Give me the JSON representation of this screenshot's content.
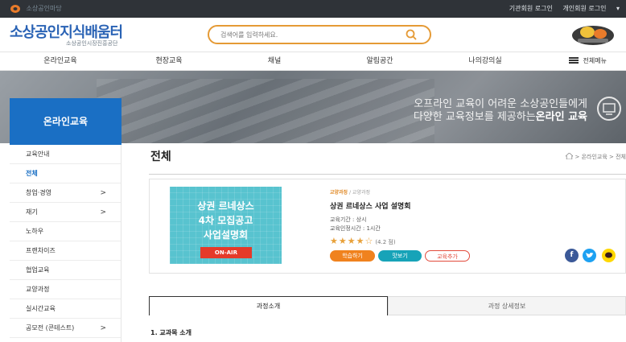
{
  "topbar": {
    "logo_text": "소상공인마당",
    "links": [
      "기관회원 로그인",
      "개인회원 로그인",
      "▾"
    ]
  },
  "header": {
    "brand_main": "소상공인지식배움터",
    "brand_sub": "소상공인시장진흥공단",
    "search_placeholder": "검색어를 입력하세요.",
    "mascot_alt": "소상공인 캐릭터"
  },
  "gnb": {
    "items": [
      "온라인교육",
      "현장교육",
      "채널",
      "알림공간",
      "나의강의실"
    ],
    "all_menu": "전체메뉴"
  },
  "hero": {
    "line1": "오프라인 교육이 어려운 소상공인들에게",
    "line2_prefix": "다양한 교육정보를 제공하는",
    "line2_bold": "온라인 교육"
  },
  "lnb": {
    "title": "온라인교육",
    "items": [
      {
        "label": "교육안내",
        "arrow": ""
      },
      {
        "label": "전체",
        "arrow": ""
      },
      {
        "label": "창업·경영",
        "arrow": ">"
      },
      {
        "label": "재기",
        "arrow": ">"
      },
      {
        "label": "노하우",
        "arrow": ""
      },
      {
        "label": "프랜차이즈",
        "arrow": ""
      },
      {
        "label": "협업교육",
        "arrow": ""
      },
      {
        "label": "교양과정",
        "arrow": ""
      },
      {
        "label": "실시간교육",
        "arrow": ""
      },
      {
        "label": "공모전 (콘테스트)",
        "arrow": ">"
      }
    ]
  },
  "content": {
    "page_title": "전체",
    "breadcrumb": "> 온라인교육 > 전체",
    "card": {
      "thumb_line1": "상권 르네상스",
      "thumb_line2": "4차 모집공고",
      "thumb_line3": "사업설명회",
      "thumb_badge": "ON-AIR",
      "category": "교양과정",
      "category_sep": " / 교양과정",
      "title": "상권 르네상스 사업 설명회",
      "period": "교육기간 : 상시",
      "hours": "교육인정시간 : 1시간",
      "stars": "★★★★☆",
      "score": "(4.2 점)",
      "btn_apply": "학습하기",
      "btn_preview": "맛보기",
      "btn_share": "교육추가"
    },
    "tabs": [
      "과정소개",
      "과정 상세정보"
    ],
    "section_title": "1. 교과목 소개"
  },
  "colors": {
    "brand_blue": "#1a6fc4",
    "accent_orange": "#f0821e",
    "teal": "#17a3b8"
  }
}
